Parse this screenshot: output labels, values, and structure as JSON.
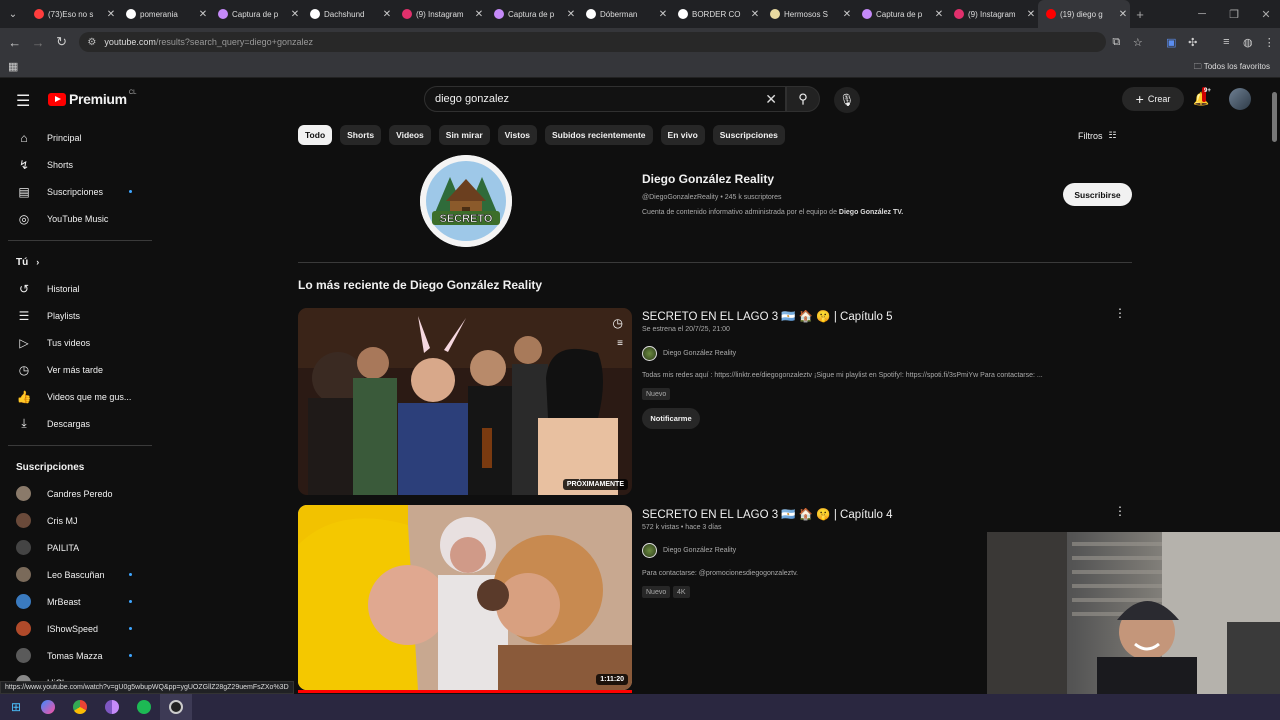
{
  "browser": {
    "tabs": [
      {
        "label": "(73)Eso no s",
        "color": "#ff3d3d"
      },
      {
        "label": "pomerania",
        "color": "#ffffff"
      },
      {
        "label": "Captura de p",
        "color": "#c58af9"
      },
      {
        "label": "Dachshund",
        "color": "#ffffff"
      },
      {
        "label": "(9) Instagram",
        "color": "#e1306c"
      },
      {
        "label": "Captura de p",
        "color": "#c58af9"
      },
      {
        "label": "Dóberman",
        "color": "#ffffff"
      },
      {
        "label": "BORDER CO",
        "color": "#ffffff"
      },
      {
        "label": "Hermosos S",
        "color": "#e8d9a0"
      },
      {
        "label": "Captura de p",
        "color": "#c58af9"
      },
      {
        "label": "(9) Instagram",
        "color": "#e1306c"
      },
      {
        "label": "(19) diego g",
        "color": "#ff0000"
      }
    ],
    "url_host": "youtube.com",
    "url_path": "/results?search_query=diego+gonzalez",
    "bookmarks_label": "Todos los favoritos"
  },
  "header": {
    "brand": "Premium",
    "country": "CL",
    "search_value": "diego gonzalez",
    "create_label": "Crear",
    "notif_badge": "9+"
  },
  "sidebar": {
    "main": [
      {
        "label": "Principal",
        "icon": "home-icon",
        "glyph": "⌂"
      },
      {
        "label": "Shorts",
        "icon": "shorts-icon",
        "glyph": "↯"
      },
      {
        "label": "Suscripciones",
        "icon": "subscriptions-icon",
        "glyph": "▤",
        "dot": true
      },
      {
        "label": "YouTube Music",
        "icon": "music-icon",
        "glyph": "◎"
      }
    ],
    "you_title": "Tú",
    "you": [
      {
        "label": "Historial",
        "icon": "history-icon",
        "glyph": "↺"
      },
      {
        "label": "Playlists",
        "icon": "playlists-icon",
        "glyph": "☰"
      },
      {
        "label": "Tus videos",
        "icon": "your-videos-icon",
        "glyph": "▷"
      },
      {
        "label": "Ver más tarde",
        "icon": "watch-later-icon",
        "glyph": "◷"
      },
      {
        "label": "Videos que me gus...",
        "icon": "liked-icon",
        "glyph": "👍"
      },
      {
        "label": "Descargas",
        "icon": "downloads-icon",
        "glyph": "⤓"
      }
    ],
    "subs_title": "Suscripciones",
    "subs": [
      {
        "label": "Candres Peredo",
        "color": "#8a7a6a",
        "dot": false
      },
      {
        "label": "Cris MJ",
        "color": "#6a4a3a",
        "dot": false
      },
      {
        "label": "PAILITA",
        "color": "#444444",
        "dot": false
      },
      {
        "label": "Leo Bascuñan",
        "color": "#7a6a5a",
        "dot": true
      },
      {
        "label": "MrBeast",
        "color": "#3a7abf",
        "dot": true
      },
      {
        "label": "IShowSpeed",
        "color": "#b04a2a",
        "dot": true
      },
      {
        "label": "Tomas Mazza",
        "color": "#5a5a5a",
        "dot": true
      },
      {
        "label": "HiClavero",
        "color": "#888888",
        "dot": false
      }
    ]
  },
  "chips": [
    "Todo",
    "Shorts",
    "Videos",
    "Sin mirar",
    "Vistos",
    "Subidos recientemente",
    "En vivo",
    "Suscripciones"
  ],
  "filters_label": "Filtros",
  "channel": {
    "name": "Diego González Reality",
    "handle": "@DiegoGonzalezReality",
    "subscribers": "245 k suscriptores",
    "desc": "Cuenta de contenido informativo administrada por el equipo de ",
    "desc_bold": "Diego González TV.",
    "subscribe_label": "Suscribirse",
    "logo_text": "SECRETO"
  },
  "latest_title": "Lo más reciente de Diego González Reality",
  "videos": [
    {
      "title": "SECRETO EN EL LAGO 3 🇦🇷 🏠 🤫 | Capítulo 5",
      "meta": "Se estrena el 20/7/25, 21:00",
      "channel": "Diego González Reality",
      "desc": "Todas mis redes aquí : https://linktr.ee/diegogonzaleztv ¡Sigue mi playlist en Spotify!: https://spoti.fi/3sPmiYw Para contactarse: ...",
      "tags": [
        "Nuevo"
      ],
      "badge": "PRÓXIMAMENTE",
      "button": "Notificarme"
    },
    {
      "title": "SECRETO EN EL LAGO 3 🇦🇷 🏠 🤫 | Capítulo 4",
      "meta": "572 k vistas • hace 3 días",
      "channel": "Diego González Reality",
      "desc": "Para contactarse: @promocionesdiegogonzaleztv.",
      "tags": [
        "Nuevo",
        "4K"
      ],
      "badge": "1:11:20"
    }
  ],
  "status_url": "https://www.youtube.com/watch?v=gU0g5wbupWQ&pp=ygUOZGllZ28gZ29uemFsZXo%3D"
}
